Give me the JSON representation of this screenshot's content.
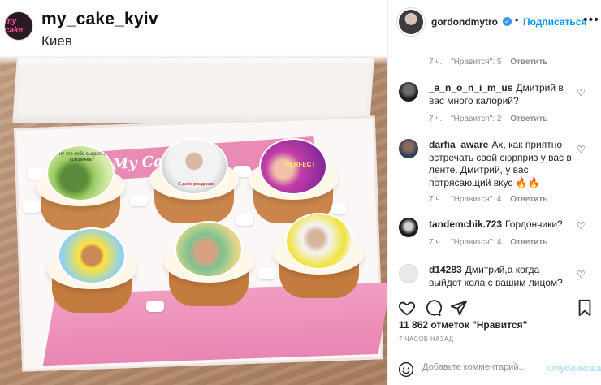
{
  "post": {
    "avatar_text": "my cake",
    "username": "my_cake_kyiv",
    "location": "Киев",
    "box_brand": "My Cake",
    "topper_texts": [
      "ну что тебе сыграть, кришинка?",
      "С днём рождения",
      "PERFECT"
    ]
  },
  "header": {
    "username": "gordondmytro",
    "verified_mark": "✓",
    "separator": "•",
    "follow_label": "Подписаться",
    "more_icon": "•••"
  },
  "comments": {
    "top_meta": {
      "time": "7 ч.",
      "likes": "\"Нравится\": 5",
      "reply": "Ответить"
    },
    "items": [
      {
        "username": "_a_n_o_n_i_m_us",
        "text": "Дмитрий в вас много калорий?",
        "time": "7 ч.",
        "likes": "\"Нравится\": 2",
        "reply": "Ответить"
      },
      {
        "username": "darfia_aware",
        "text": "Ах, как приятно встречать свой сюрприз у вас в ленте. Дмитрий, у вас потрясающий вкус 🔥🔥",
        "time": "7 ч.",
        "likes": "\"Нравится\": 4",
        "reply": "Ответить"
      },
      {
        "username": "tandemchik.723",
        "text": "Гордончики?",
        "time": "7 ч.",
        "likes": "\"Нравится\": 4",
        "reply": "Ответить"
      },
      {
        "username": "d14283",
        "text": "Дмитрий,а когда выйдет кола с вашим лицом?",
        "time": "",
        "likes": "",
        "reply": ""
      }
    ]
  },
  "stats": {
    "likes": "11 862 отметок \"Нравится\"",
    "time": "7 ЧАСОВ НАЗАД"
  },
  "composer": {
    "placeholder": "Добавьте комментарий...",
    "publish_label": "Опубликовать"
  },
  "colors": {
    "link_blue": "#0095f6",
    "box_pink": "#e985b2",
    "publish_disabled": "#b2dffc"
  }
}
